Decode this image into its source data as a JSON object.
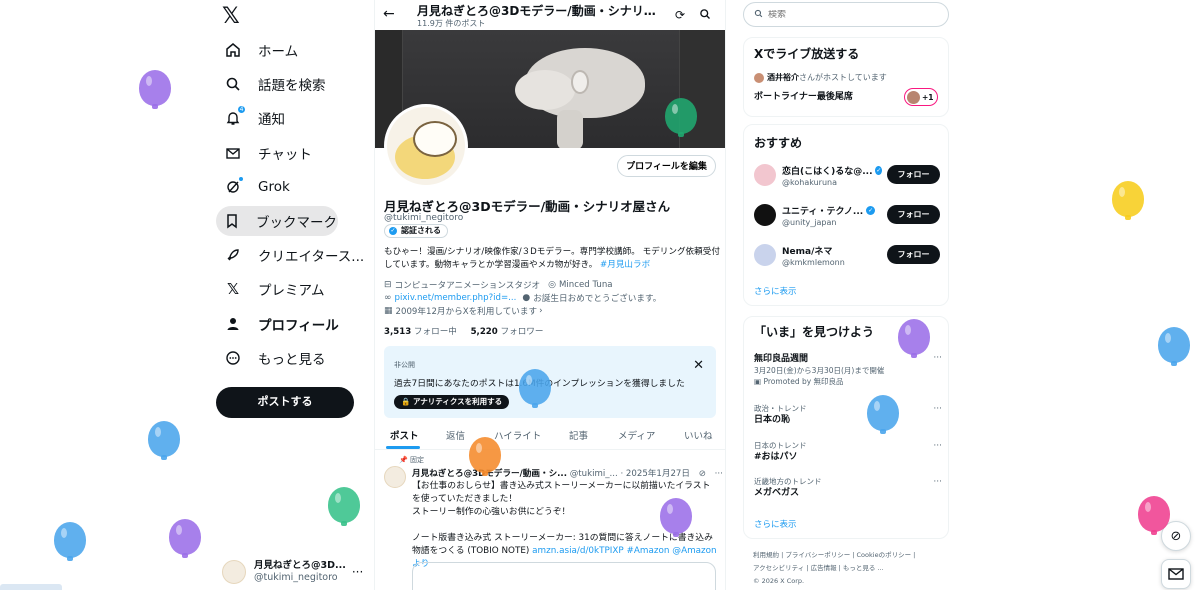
{
  "nav": {
    "logo": "𝕏",
    "items": [
      {
        "label": "ホーム",
        "icon": "home-icon"
      },
      {
        "label": "話題を検索",
        "icon": "search-icon"
      },
      {
        "label": "通知",
        "icon": "bell-icon",
        "badge": "4"
      },
      {
        "label": "チャット",
        "icon": "mail-icon"
      },
      {
        "label": "Grok",
        "icon": "grok-icon"
      },
      {
        "label": "ブックマーク",
        "icon": "bookmark-icon",
        "active": true
      },
      {
        "label": "クリエイタース...",
        "icon": "rocket-icon"
      },
      {
        "label": "プレミアム",
        "icon": "x-premium-icon"
      },
      {
        "label": "プロフィール",
        "icon": "person-icon",
        "bold": true
      },
      {
        "label": "もっと見る",
        "icon": "more-circle-icon"
      }
    ],
    "post_button": "ポストする",
    "account": {
      "name": "月見ねぎとろ@3D...",
      "handle": "@tukimi_negitoro",
      "more": "···"
    }
  },
  "main": {
    "header": {
      "title": "月見ねぎとろ@3Dモデラー/動画・シナリオ...",
      "post_count": "11.9万 件のポスト"
    },
    "edit_profile": "プロフィールを編集",
    "profile": {
      "name": "月見ねぎとろ@3Dモデラー/動画・シナリオ屋さん",
      "handle": "@tukimi_negitoro",
      "verify_label": "認証される",
      "bio": "もひゃー！漫画/シナリオ/映像作家/３Dモデラー。専門学校講師。 モデリング依頼受付しています。動物キャラとか学習漫画やメカ物が好き。",
      "bio_tag": "#月見山ラボ",
      "category": "コンピュータアニメーションスタジオ",
      "location": "Minced Tuna",
      "link": "pixiv.net/member.php?id=...",
      "birthday": "お誕生日おめでとうございます。",
      "joined": "2009年12月からXを利用しています",
      "following_count": "3,513",
      "following_label": "フォロー中",
      "followers_count": "5,220",
      "followers_label": "フォロワー"
    },
    "notice": {
      "caption": "非公開",
      "text": "過去7日間にあなたのポストは1.6M件のインプレッションを獲得しました",
      "button": "アナリティクスを利用する",
      "close": "✕"
    },
    "tabs": [
      "ポスト",
      "返信",
      "ハイライト",
      "記事",
      "メディア",
      "いいね"
    ],
    "pinned_label": "固定",
    "tweet": {
      "name": "月見ねぎとろ@3Dモデラー/動画・シ...",
      "handle": "@tukimi_...",
      "date": "· 2025年1月27日",
      "line1": "【お仕事のおしらせ】書き込み式ストーリーメーカーに以前描いたイラストを使っていただきました！",
      "line2": "ストーリー制作の心強いお供にどうぞ！",
      "line3": "ノート版書き込み式 ストーリーメーカー: 31の質問に答えノートに書き込み物語をつくる (TOBIO NOTE)",
      "link1": "amzn.asia/d/0kTPIXP",
      "tag1": "#Amazon",
      "tag2": "@Amazonより"
    }
  },
  "side": {
    "search_placeholder": "検索",
    "live": {
      "title": "Xでライブ放送する",
      "host_name": "酒井裕介",
      "host_suffix": "さんがホストしています",
      "space_title": "ボートライナー最後尾席",
      "plus": "+1"
    },
    "recommend": {
      "title": "おすすめ",
      "users": [
        {
          "name": "恋白(こはく)るな@...",
          "handle": "@kohakuruna",
          "button": "フォロー",
          "color": "#f2c6cf"
        },
        {
          "name": "ユニティ・テクノ...",
          "handle": "@unity_japan",
          "button": "フォロー",
          "color": "#111111"
        },
        {
          "name": "Nema/ネマ",
          "handle": "@kmkmlemonn",
          "button": "フォロー",
          "color": "#c9d3ec"
        }
      ],
      "more": "さらに表示"
    },
    "trends": {
      "title": "「いま」を見つけよう",
      "items": [
        {
          "category": "",
          "title": "無印良品週間",
          "sub": "3月20日(金)から3月30日(月)まで開催",
          "promo": "Promoted by 無印良品"
        },
        {
          "category": "政治・トレンド",
          "title": "日本の恥",
          "sub": "",
          "promo": ""
        },
        {
          "category": "日本のトレンド",
          "title": "#おはパソ",
          "sub": "",
          "promo": ""
        },
        {
          "category": "近畿地方のトレンド",
          "title": "メガベガス",
          "sub": "",
          "promo": ""
        }
      ],
      "more": "さらに表示"
    },
    "footer": {
      "line1": "利用規約 | プライバシーポリシー | Cookieのポリシー |",
      "line2": "アクセシビリティ | 広告情報 | もっと見る ...",
      "line3": "© 2026 X Corp."
    }
  },
  "colors": {
    "accent": "#1d9bf0",
    "text": "#0f1419",
    "muted": "#536471",
    "border": "#eff3f4"
  }
}
